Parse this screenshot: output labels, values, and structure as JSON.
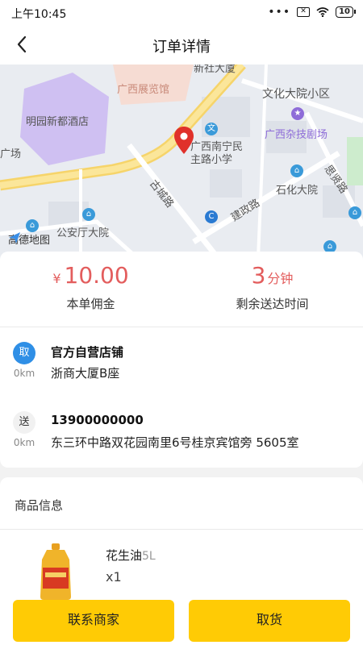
{
  "status_bar": {
    "time": "上午10:45",
    "battery": "10"
  },
  "nav": {
    "title": "订单详情"
  },
  "map": {
    "labels": {
      "hotel": "明园新都酒店",
      "exhibition": "广西展览馆",
      "top_road": "新社大厦",
      "culture": "文化大院小区",
      "theater": "广西杂技剧场",
      "school": "广西南宁民\n主路小学",
      "shihua": "石化大院",
      "sixian": "思贤路",
      "gucheng": "古城路",
      "jianzheng": "建政路",
      "police": "公安厅大院",
      "square": "广场",
      "provider": "高德地图"
    }
  },
  "order": {
    "commission": {
      "prefix": "¥",
      "value": "10.00",
      "label": "本单佣金"
    },
    "remaining": {
      "value": "3",
      "unit": "分钟",
      "label": "剩余送达时间"
    }
  },
  "pickup": {
    "tag": "取",
    "distance": "0km",
    "name": "官方自营店铺",
    "address": "浙商大厦B座"
  },
  "delivery": {
    "tag": "送",
    "distance": "0km",
    "phone": "13900000000",
    "address": "东三环中路双花园南里6号桂京宾馆旁 5605室"
  },
  "goods": {
    "heading": "商品信息",
    "items": [
      {
        "name": "花生油",
        "spec": "5L",
        "qty": "x1"
      }
    ]
  },
  "actions": {
    "contact": "联系商家",
    "pickup": "取货"
  },
  "colors": {
    "accent": "#ffcb05",
    "price": "#e35d5d",
    "pickup_tag": "#2f8fe6"
  }
}
